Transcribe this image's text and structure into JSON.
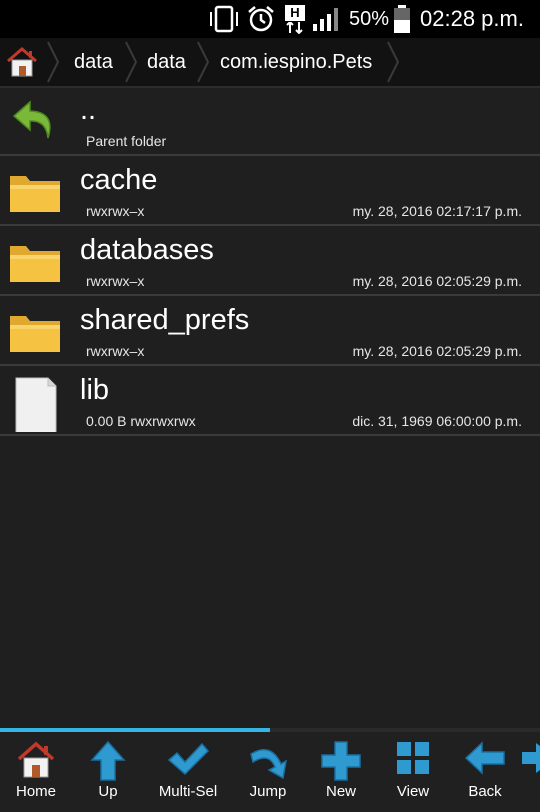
{
  "status_bar": {
    "network": "H",
    "battery": "50%",
    "time": "02:28 p.m."
  },
  "breadcrumb": {
    "items": [
      "data",
      "data",
      "com.iespino.Pets"
    ]
  },
  "files": [
    {
      "name": "..",
      "meta": "Parent folder",
      "date": "",
      "icon": "back-arrow-icon"
    },
    {
      "name": "cache",
      "meta": "rwxrwx–x",
      "date": "my. 28, 2016 02:17:17 p.m.",
      "icon": "folder-icon"
    },
    {
      "name": "databases",
      "meta": "rwxrwx–x",
      "date": "my. 28, 2016 02:05:29 p.m.",
      "icon": "folder-icon"
    },
    {
      "name": "shared_prefs",
      "meta": "rwxrwx–x",
      "date": "my. 28, 2016 02:05:29 p.m.",
      "icon": "folder-icon"
    },
    {
      "name": "lib",
      "meta": "0.00 B rwxrwxrwx",
      "date": "dic. 31, 1969 06:00:00 p.m.",
      "icon": "file-icon"
    }
  ],
  "toolbar": {
    "progress": 0.5,
    "buttons": [
      "Home",
      "Up",
      "Multi-Sel",
      "Jump",
      "New",
      "View",
      "Back"
    ]
  },
  "colors": {
    "accent": "#33b5e5",
    "folder": "#f5c242",
    "back_arrow": "#7ab83a"
  }
}
